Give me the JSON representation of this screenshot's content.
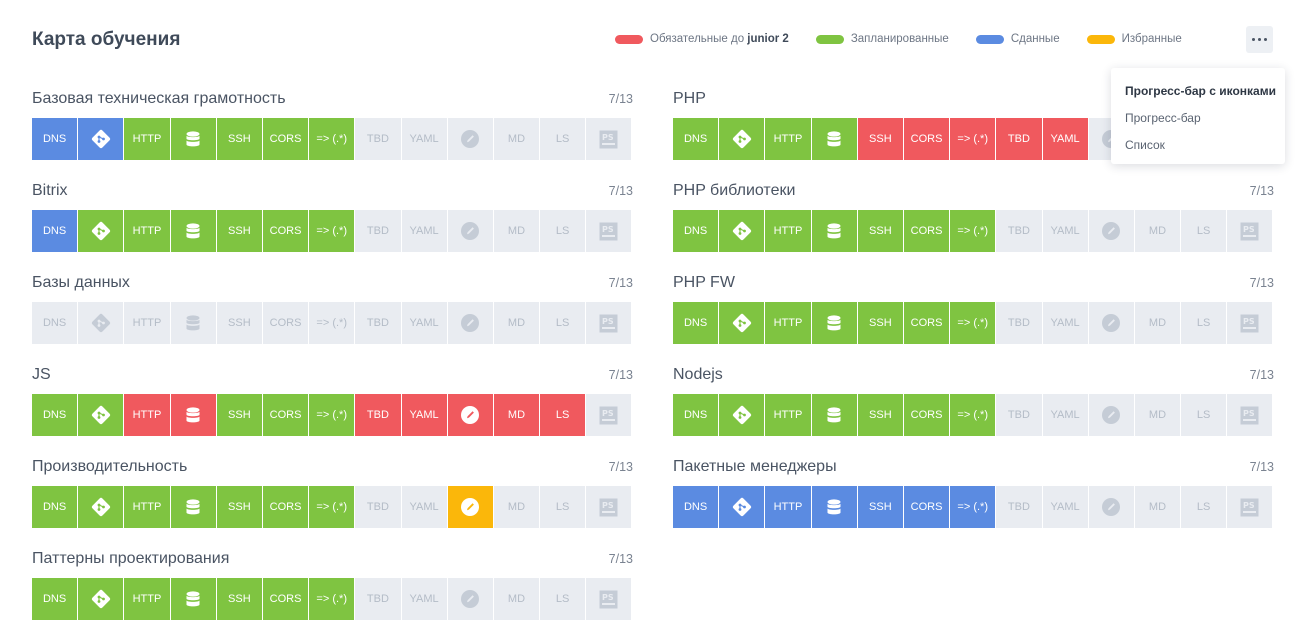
{
  "page": {
    "title": "Карта обучения"
  },
  "legend": [
    {
      "label_plain": "Обязательные до ",
      "label_bold": "junior 2",
      "color": "#f0595e"
    },
    {
      "label_plain": "Запланированные",
      "label_bold": "",
      "color": "#7fc441"
    },
    {
      "label_plain": "Сданные",
      "label_bold": "",
      "color": "#5b8be1"
    },
    {
      "label_plain": "Избранные",
      "label_bold": "",
      "color": "#fbb70a"
    }
  ],
  "status_colors": {
    "done": "#5b8be1",
    "planned": "#7fc441",
    "required": "#f0595e",
    "favorite": "#fbb70a",
    "empty": "#e9ecf1"
  },
  "menu": {
    "icon": "more-dots-icon",
    "items": [
      {
        "label": "Прогресс-бар с иконками",
        "active": true
      },
      {
        "label": "Прогресс-бар",
        "active": false
      },
      {
        "label": "Список",
        "active": false
      }
    ]
  },
  "cell_types": [
    {
      "label": "DNS",
      "icon": ""
    },
    {
      "label": "",
      "icon": "git-icon"
    },
    {
      "label": "HTTP",
      "icon": ""
    },
    {
      "label": "",
      "icon": "database-icon"
    },
    {
      "label": "SSH",
      "icon": ""
    },
    {
      "label": "CORS",
      "icon": ""
    },
    {
      "label": "=> (.*)",
      "icon": ""
    },
    {
      "label": "TBD",
      "icon": ""
    },
    {
      "label": "YAML",
      "icon": ""
    },
    {
      "label": "",
      "icon": "pencil-icon"
    },
    {
      "label": "MD",
      "icon": ""
    },
    {
      "label": "LS",
      "icon": ""
    },
    {
      "label": "",
      "icon": "photoshop-icon"
    }
  ],
  "sections": [
    {
      "title": "Базовая техническая грамотность",
      "count": "7/13",
      "statuses": [
        "done",
        "done",
        "planned",
        "planned",
        "planned",
        "planned",
        "planned",
        "empty",
        "empty",
        "empty",
        "empty",
        "empty",
        "empty"
      ]
    },
    {
      "title": "PHP",
      "count": "7/13",
      "statuses": [
        "planned",
        "planned",
        "planned",
        "planned",
        "required",
        "required",
        "required",
        "required",
        "required",
        "empty",
        "empty",
        "empty",
        "empty"
      ]
    },
    {
      "title": "Bitrix",
      "count": "7/13",
      "statuses": [
        "done",
        "planned",
        "planned",
        "planned",
        "planned",
        "planned",
        "planned",
        "empty",
        "empty",
        "empty",
        "empty",
        "empty",
        "empty"
      ]
    },
    {
      "title": "PHP библиотеки",
      "count": "7/13",
      "statuses": [
        "planned",
        "planned",
        "planned",
        "planned",
        "planned",
        "planned",
        "planned",
        "empty",
        "empty",
        "empty",
        "empty",
        "empty",
        "empty"
      ]
    },
    {
      "title": "Базы данных",
      "count": "7/13",
      "statuses": [
        "empty",
        "empty",
        "empty",
        "empty",
        "empty",
        "empty",
        "empty",
        "empty",
        "empty",
        "empty",
        "empty",
        "empty",
        "empty"
      ]
    },
    {
      "title": "PHP FW",
      "count": "7/13",
      "statuses": [
        "planned",
        "planned",
        "planned",
        "planned",
        "planned",
        "planned",
        "planned",
        "empty",
        "empty",
        "empty",
        "empty",
        "empty",
        "empty"
      ]
    },
    {
      "title": "JS",
      "count": "7/13",
      "statuses": [
        "planned",
        "planned",
        "required",
        "required",
        "planned",
        "planned",
        "planned",
        "required",
        "required",
        "required",
        "required",
        "required",
        "empty"
      ]
    },
    {
      "title": "Nodejs",
      "count": "7/13",
      "statuses": [
        "planned",
        "planned",
        "planned",
        "planned",
        "planned",
        "planned",
        "planned",
        "empty",
        "empty",
        "empty",
        "empty",
        "empty",
        "empty"
      ]
    },
    {
      "title": "Производительность",
      "count": "7/13",
      "statuses": [
        "planned",
        "planned",
        "planned",
        "planned",
        "planned",
        "planned",
        "planned",
        "empty",
        "empty",
        "favorite",
        "empty",
        "empty",
        "empty"
      ]
    },
    {
      "title": "Пакетные менеджеры",
      "count": "7/13",
      "statuses": [
        "done",
        "done",
        "done",
        "done",
        "done",
        "done",
        "done",
        "empty",
        "empty",
        "empty",
        "empty",
        "empty",
        "empty"
      ]
    },
    {
      "title": "Паттерны проектирования",
      "count": "7/13",
      "statuses": [
        "planned",
        "planned",
        "planned",
        "planned",
        "planned",
        "planned",
        "planned",
        "empty",
        "empty",
        "empty",
        "empty",
        "empty",
        "empty"
      ]
    }
  ]
}
